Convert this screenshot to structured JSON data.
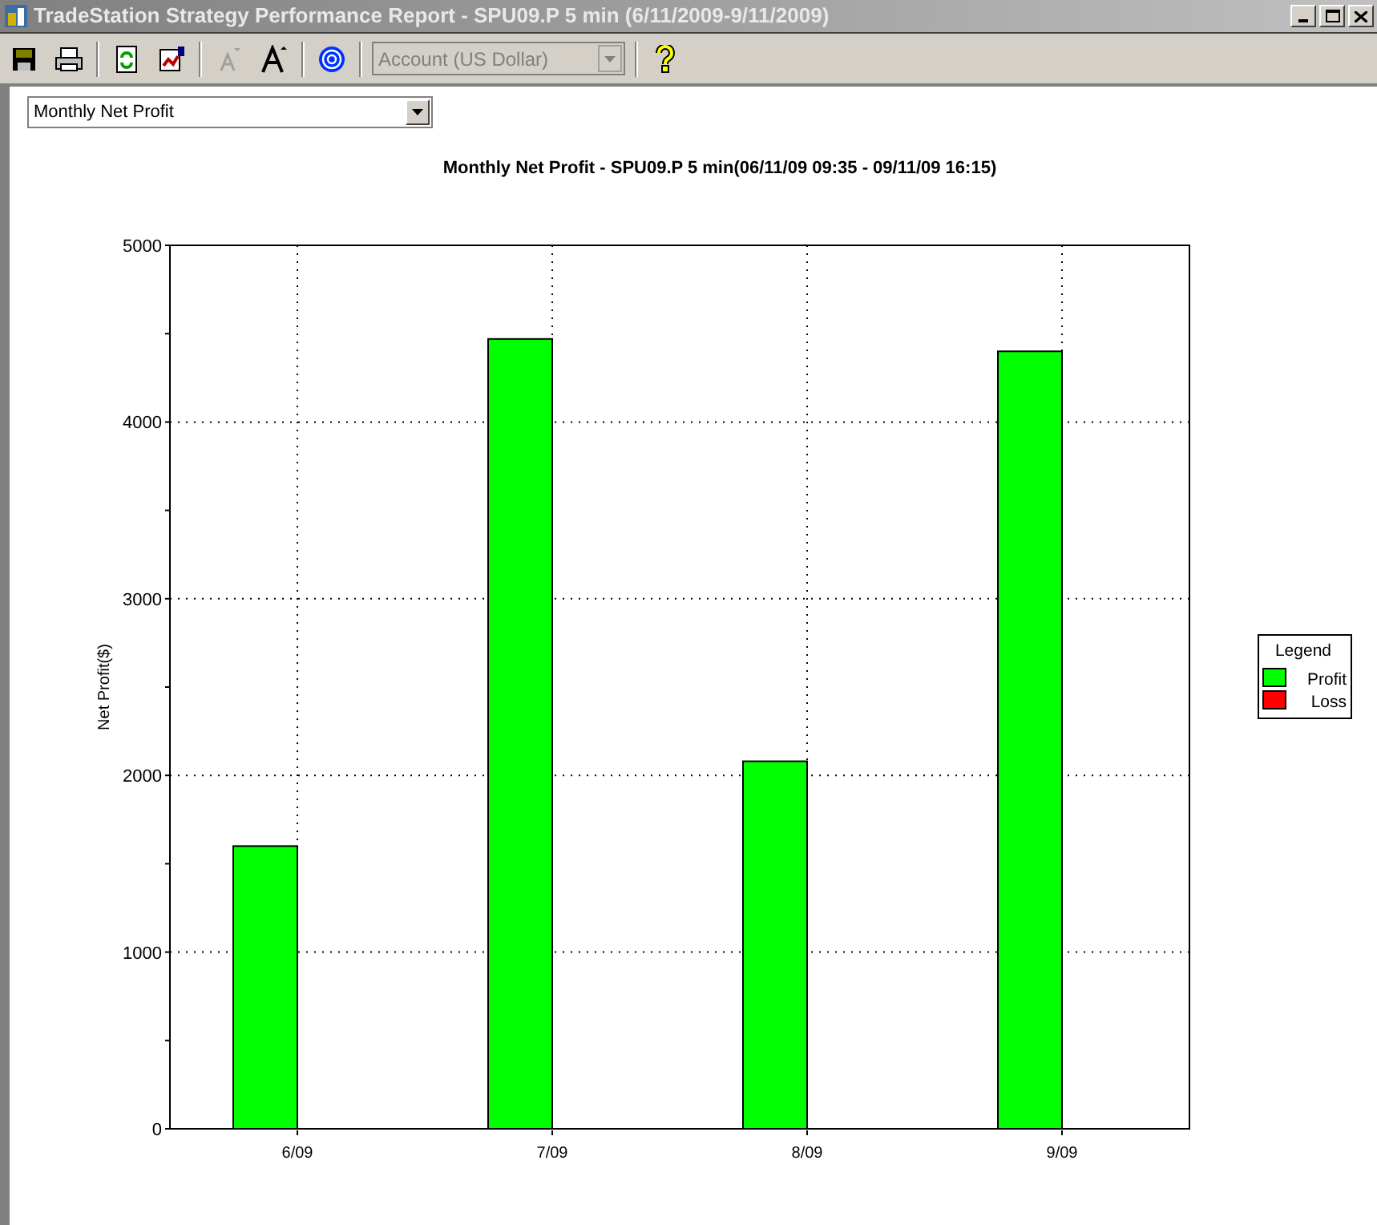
{
  "window": {
    "title": "TradeStation Strategy Performance Report - SPU09.P 5 min (6/11/2009-9/11/2009)"
  },
  "toolbar": {
    "buttons": [
      {
        "kind": "save",
        "disabled": false
      },
      {
        "kind": "print",
        "disabled": false
      },
      {
        "kind": "refresh",
        "disabled": false
      },
      {
        "kind": "export",
        "disabled": false
      },
      {
        "kind": "font-smaller",
        "disabled": true
      },
      {
        "kind": "font-larger",
        "disabled": false
      },
      {
        "kind": "target",
        "disabled": false
      },
      {
        "kind": "account-select",
        "value": "Account (US Dollar)",
        "disabled": true
      },
      {
        "kind": "help",
        "disabled": false
      }
    ]
  },
  "report_select": {
    "value": "Monthly Net Profit"
  },
  "chart": {
    "legend_title": "Legend",
    "chart_data": {
      "type": "bar",
      "title": "Monthly Net Profit - SPU09.P 5 min(06/11/09 09:35 - 09/11/09 16:15)",
      "ylabel": "Net Profit($)",
      "categories": [
        "6/09",
        "7/09",
        "8/09",
        "9/09"
      ],
      "series": [
        {
          "name": "Profit",
          "color": "#00ff00",
          "values": [
            1600,
            4470,
            2080,
            4400
          ]
        },
        {
          "name": "Loss",
          "color": "#ff0000",
          "values": [
            null,
            null,
            null,
            null
          ]
        }
      ],
      "ylim": [
        0,
        5000
      ],
      "yticks": [
        0,
        1000,
        2000,
        3000,
        4000,
        5000
      ],
      "grid": true
    }
  }
}
